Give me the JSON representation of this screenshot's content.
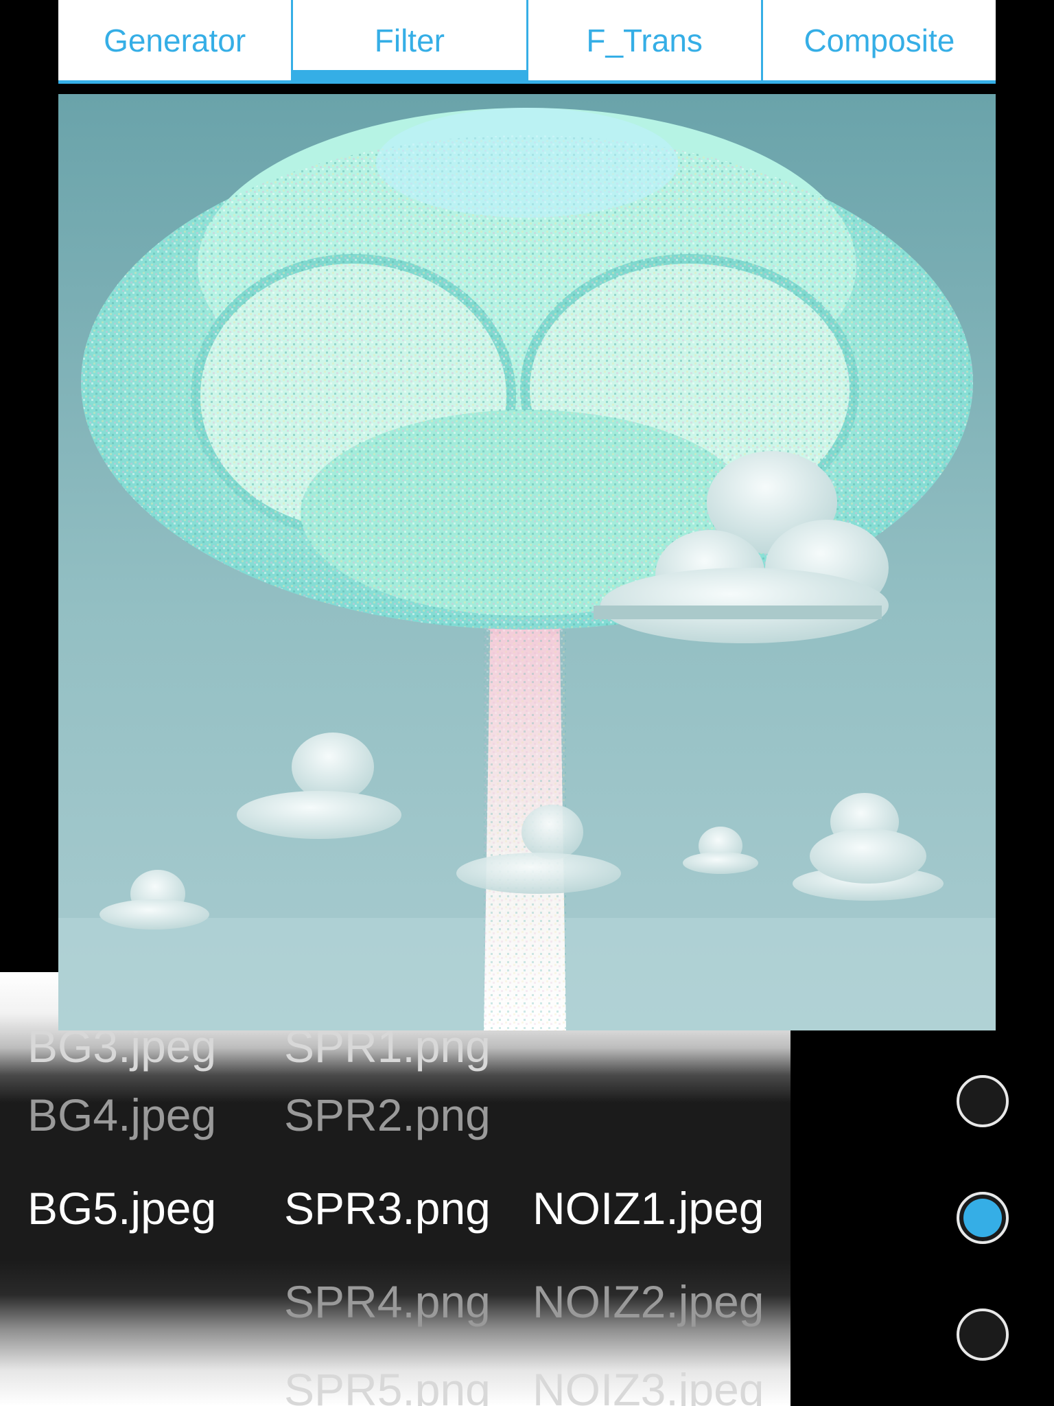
{
  "tabs": [
    {
      "label": "Generator",
      "active": false
    },
    {
      "label": "Filter",
      "active": true
    },
    {
      "label": "F_Trans",
      "active": false
    },
    {
      "label": "Composite",
      "active": false
    }
  ],
  "accent_color": "#35aee6",
  "picker": {
    "bg_options": [
      "BG3.jpeg",
      "BG4.jpeg",
      "BG5.jpeg"
    ],
    "bg_selected": "BG5.jpeg",
    "spr_options": [
      "SPR1.png",
      "SPR2.png",
      "SPR3.png",
      "SPR4.png",
      "SPR5.png"
    ],
    "spr_selected": "SPR3.png",
    "noiz_options": [
      "NOIZ1.jpeg",
      "NOIZ2.jpeg",
      "NOIZ3.jpeg"
    ],
    "noiz_selected": "NOIZ1.jpeg"
  },
  "radio_options": [
    {
      "checked": false
    },
    {
      "checked": true
    },
    {
      "checked": false
    }
  ],
  "image": {
    "subject": "glitch-filtered tree with clouds"
  }
}
